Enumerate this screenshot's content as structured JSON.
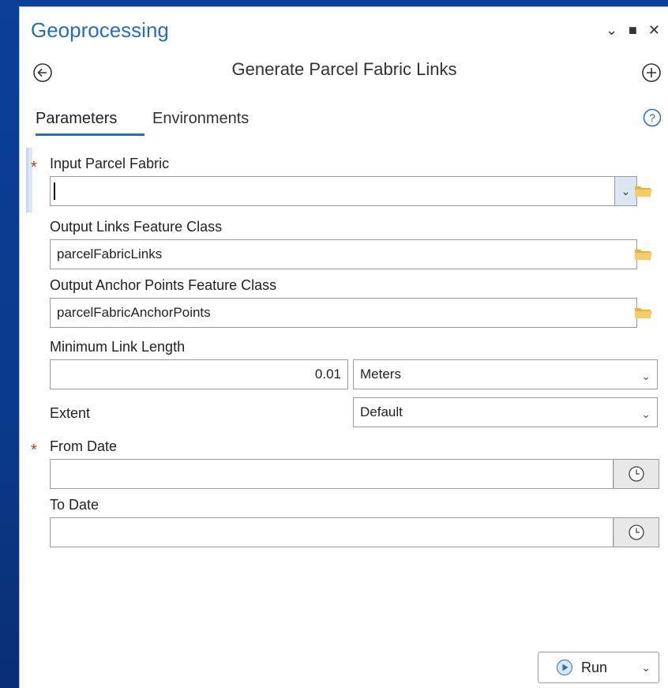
{
  "window": {
    "title": "Geoprocessing",
    "controls": {
      "collapse": "⌄",
      "maximize": "■",
      "close": "✕"
    }
  },
  "tool": {
    "title": "Generate Parcel Fabric Links"
  },
  "tabs": [
    {
      "label": "Parameters",
      "active": true
    },
    {
      "label": "Environments",
      "active": false
    }
  ],
  "params": {
    "input_parcel_fabric": {
      "label": "Input Parcel Fabric",
      "required": true,
      "value": ""
    },
    "output_links": {
      "label": "Output Links Feature Class",
      "value": "parcelFabricLinks"
    },
    "output_anchor": {
      "label": "Output Anchor Points Feature Class",
      "value": "parcelFabricAnchorPoints"
    },
    "min_link_length": {
      "label": "Minimum Link Length",
      "value": "0.01",
      "unit": "Meters"
    },
    "extent": {
      "label": "Extent",
      "value": "Default"
    },
    "from_date": {
      "label": "From Date",
      "required": true,
      "value": ""
    },
    "to_date": {
      "label": "To Date",
      "value": ""
    }
  },
  "required_marker": "*",
  "run": {
    "label": "Run"
  },
  "icons": {
    "back": "back-arrow-icon",
    "add": "add-icon",
    "help": "help-icon",
    "folder": "folder-icon",
    "clock": "clock-icon",
    "play": "play-icon"
  },
  "colors": {
    "accent": "#2a6db0",
    "required": "#c0392b",
    "folder": "#f0c14b",
    "background": "#0b3f98"
  }
}
